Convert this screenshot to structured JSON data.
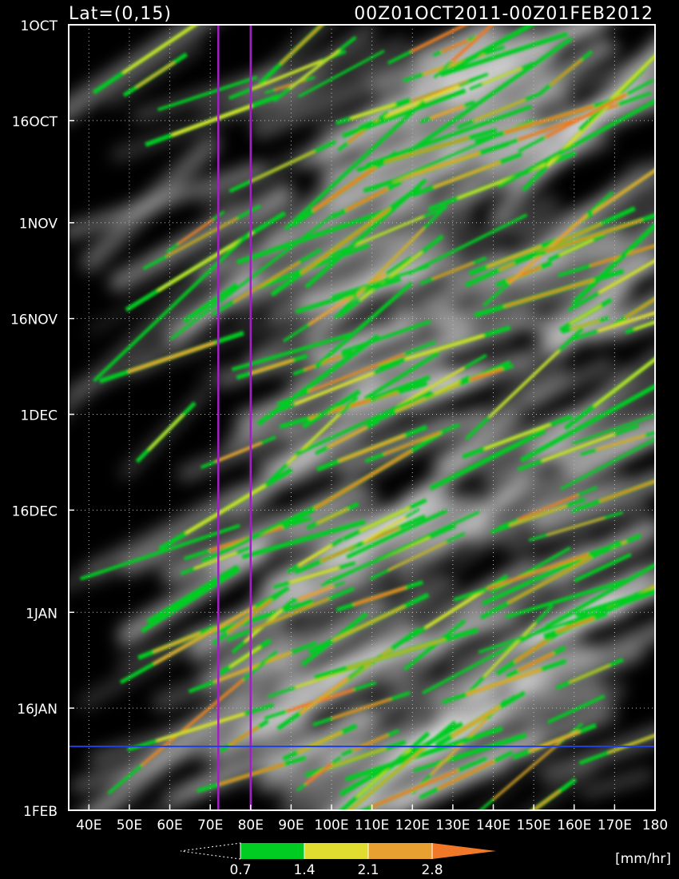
{
  "chart_data": {
    "type": "heatmap",
    "title_left": "Lat=(0,15)",
    "title_right": "00Z01OCT2011-00Z01FEB2012",
    "x_ticks": [
      "40E",
      "50E",
      "60E",
      "70E",
      "80E",
      "90E",
      "100E",
      "110E",
      "120E",
      "130E",
      "140E",
      "150E",
      "160E",
      "170E",
      "180"
    ],
    "x_range": [
      35,
      180
    ],
    "y_ticks": [
      "1OCT",
      "16OCT",
      "1NOV",
      "16NOV",
      "1DEC",
      "16DEC",
      "1JAN",
      "16JAN",
      "1FEB"
    ],
    "time_range_days": [
      0,
      123
    ],
    "colorbar": {
      "levels": [
        "0.7",
        "1.4",
        "2.1",
        "2.8"
      ],
      "colors": [
        "#00cc22",
        "#e0dc30",
        "#e8a030",
        "#f07828"
      ],
      "units": "[mm/hr]"
    },
    "vertical_lines_lon": [
      72,
      80
    ],
    "vertical_line_color": "#a020c0",
    "horizontal_line_day": 113,
    "horizontal_line_color": "#2040e0",
    "grid": true,
    "background": "#000000"
  }
}
